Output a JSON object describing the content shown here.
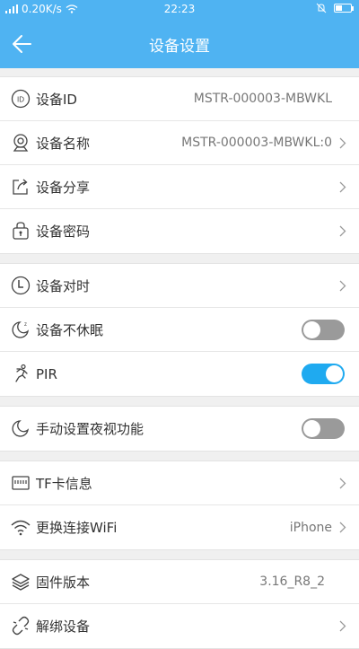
{
  "status_bar": {
    "speed": "0.20K/s",
    "time": "22:23"
  },
  "header": {
    "title": "设备设置"
  },
  "groups": [
    {
      "rows": [
        {
          "label": "设备ID",
          "value": "MSTR-000003-MBWKL",
          "icon": "id-icon",
          "arrow": false
        },
        {
          "label": "设备名称",
          "value": "MSTR-000003-MBWKL:0",
          "icon": "webcam-icon",
          "arrow": true
        },
        {
          "label": "设备分享",
          "value": "",
          "icon": "share-icon",
          "arrow": true
        },
        {
          "label": "设备密码",
          "value": "",
          "icon": "lock-bag-icon",
          "arrow": true
        }
      ]
    },
    {
      "rows": [
        {
          "label": "设备对时",
          "value": "",
          "icon": "clock-icon",
          "arrow": true
        },
        {
          "label": "设备不休眠",
          "value": "",
          "icon": "sleep-moon-icon",
          "toggle": false
        },
        {
          "label": "PIR",
          "value": "",
          "icon": "running-person-icon",
          "toggle": true
        }
      ]
    },
    {
      "rows": [
        {
          "label": "手动设置夜视功能",
          "value": "",
          "icon": "moon-icon",
          "toggle": false
        }
      ]
    },
    {
      "rows": [
        {
          "label": "TF卡信息",
          "value": "",
          "icon": "sd-card-icon",
          "arrow": true
        },
        {
          "label": "更换连接WiFi",
          "value": "iPhone",
          "icon": "wifi-icon",
          "arrow": true
        }
      ]
    },
    {
      "rows": [
        {
          "label": "固件版本",
          "value": "3.16_R8_2",
          "icon": "layers-icon",
          "arrow": false
        },
        {
          "label": "解绑设备",
          "value": "",
          "icon": "unlink-icon",
          "arrow": true
        }
      ]
    }
  ],
  "colors": {
    "primary": "#4fb3f2",
    "toggle_on": "#1faaf0",
    "toggle_off": "#9a9a9a"
  }
}
